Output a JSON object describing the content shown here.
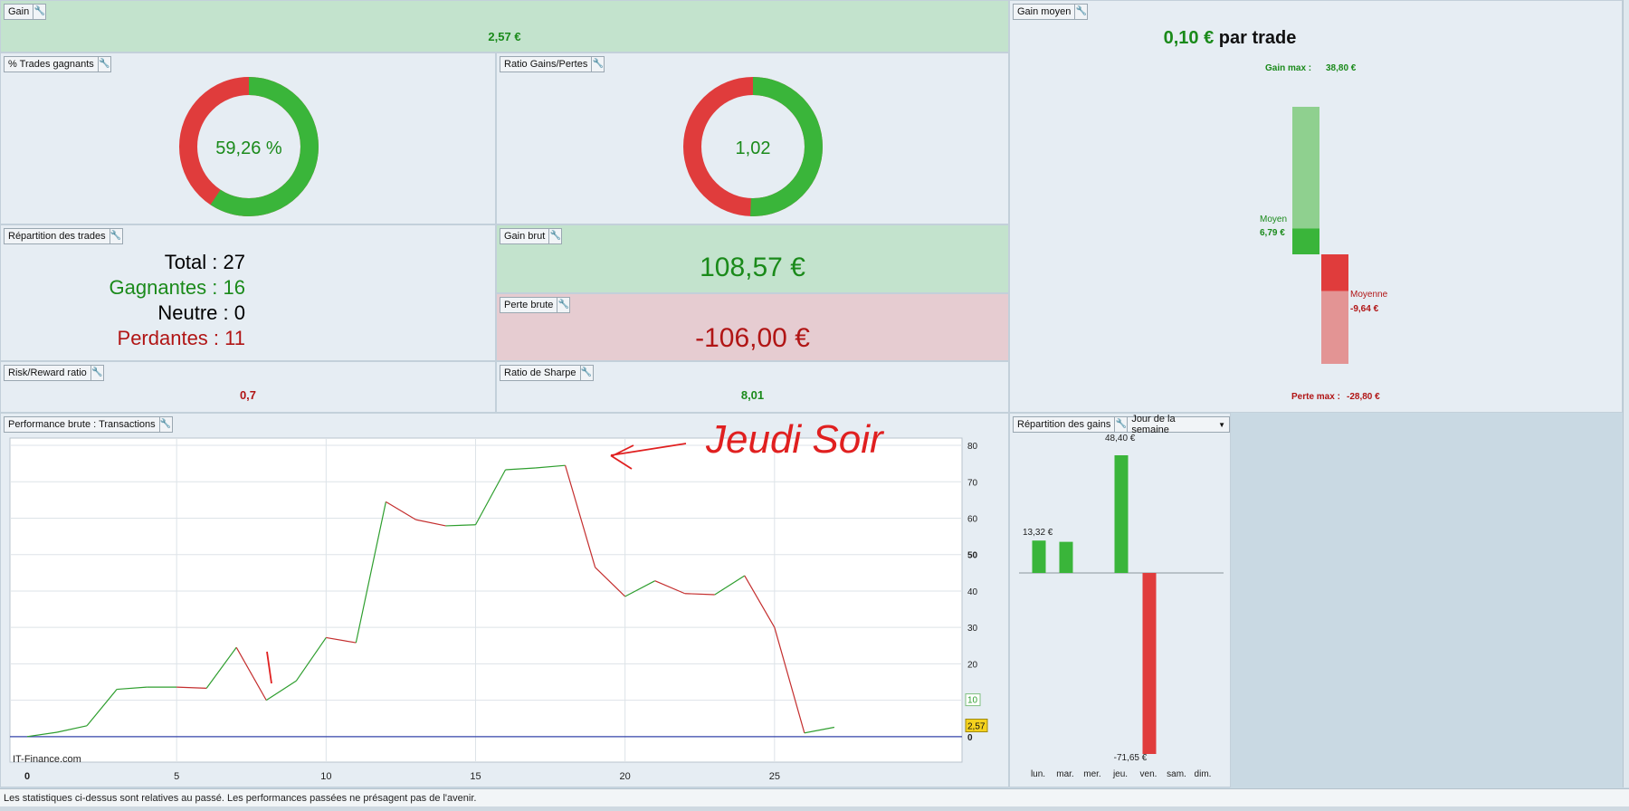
{
  "colors": {
    "green": "#3ab53a",
    "red": "#e03c3c",
    "light_green": "#8fd08f",
    "light_red": "#e39494",
    "axis_blue": "#3344aa",
    "annotation_red": "#e02020"
  },
  "gain": {
    "title": "Gain",
    "value": "2,57 €"
  },
  "gain_moyen": {
    "title": "Gain moyen",
    "value": "0,10 €",
    "suffix": "par trade",
    "gain_max_label": "Gain max :",
    "gain_max_value": "38,80 €",
    "moyen_label": "Moyen",
    "moyen_value": "6,79 €",
    "moyenne_label": "Moyenne",
    "moyenne_value": "-9,64 €",
    "perte_max_label": "Perte max :",
    "perte_max_value": "-28,80 €",
    "bars": {
      "gain_max": 38.8,
      "gain_avg": 6.79,
      "loss_avg": -9.64,
      "loss_max": -28.8
    }
  },
  "trades_gagnants": {
    "title": "% Trades gagnants",
    "value": "59,26 %",
    "fraction": 0.5926
  },
  "ratio_gains_pertes": {
    "title": "Ratio Gains/Pertes",
    "value": "1,02",
    "fraction": 0.5059
  },
  "repartition_trades": {
    "title": "Répartition des trades",
    "total_label": "Total :",
    "total_value": "27",
    "gagnantes_label": "Gagnantes :",
    "gagnantes_value": "16",
    "neutre_label": "Neutre :",
    "neutre_value": "0",
    "perdantes_label": "Perdantes :",
    "perdantes_value": "11"
  },
  "gain_brut": {
    "title": "Gain brut",
    "value": "108,57 €"
  },
  "perte_brute": {
    "title": "Perte brute",
    "value": "-106,00 €"
  },
  "risk_reward": {
    "title": "Risk/Reward ratio",
    "value": "0,7"
  },
  "sharpe": {
    "title": "Ratio de Sharpe",
    "value": "8,01"
  },
  "performance": {
    "title": "Performance brute : Transactions",
    "watermark": "IT-Finance.com",
    "annotation": "Jeudi Soir",
    "last_value_label": "2,57",
    "marker_label": "10",
    "chart_data": {
      "type": "line",
      "x": [
        0,
        1,
        2,
        3,
        4,
        5,
        6,
        7,
        8,
        9,
        10,
        11,
        12,
        13,
        14,
        15,
        16,
        17,
        18,
        19,
        20,
        21,
        22,
        23,
        24,
        25,
        26,
        27
      ],
      "values": [
        0,
        1.2,
        3,
        13,
        13.6,
        13.6,
        13.3,
        24.5,
        10,
        15.3,
        27.2,
        25.8,
        64.5,
        59.6,
        57.9,
        58.2,
        73.3,
        73.8,
        74.5,
        46.5,
        38.5,
        42.8,
        39.3,
        39,
        44.2,
        30,
        1,
        2.57
      ],
      "xlim": [
        0,
        30
      ],
      "ylim": [
        -7,
        82
      ],
      "x_ticks": [
        "0",
        "5",
        "10",
        "15",
        "20",
        "25"
      ],
      "y_ticks": [
        "80",
        "70",
        "60",
        "50",
        "40",
        "30",
        "20",
        "10",
        "0"
      ],
      "grid": true
    }
  },
  "repartition_gains": {
    "title": "Répartition des gains",
    "selector": "Jour de la semaine",
    "label_mon": "13,32 €",
    "label_thu_pos": "48,40 €",
    "label_thu_neg": "-71,65 €",
    "chart_data": {
      "type": "bar",
      "categories": [
        "lun.",
        "mar.",
        "mer.",
        "jeu.",
        "ven.",
        "sam.",
        "dim."
      ],
      "values": [
        13.32,
        12.8,
        0,
        48.4,
        -71.65,
        0,
        0
      ]
    }
  },
  "footer": {
    "text": "Les statistiques ci-dessus sont relatives au passé. Les performances passées ne présagent pas de l'avenir."
  }
}
